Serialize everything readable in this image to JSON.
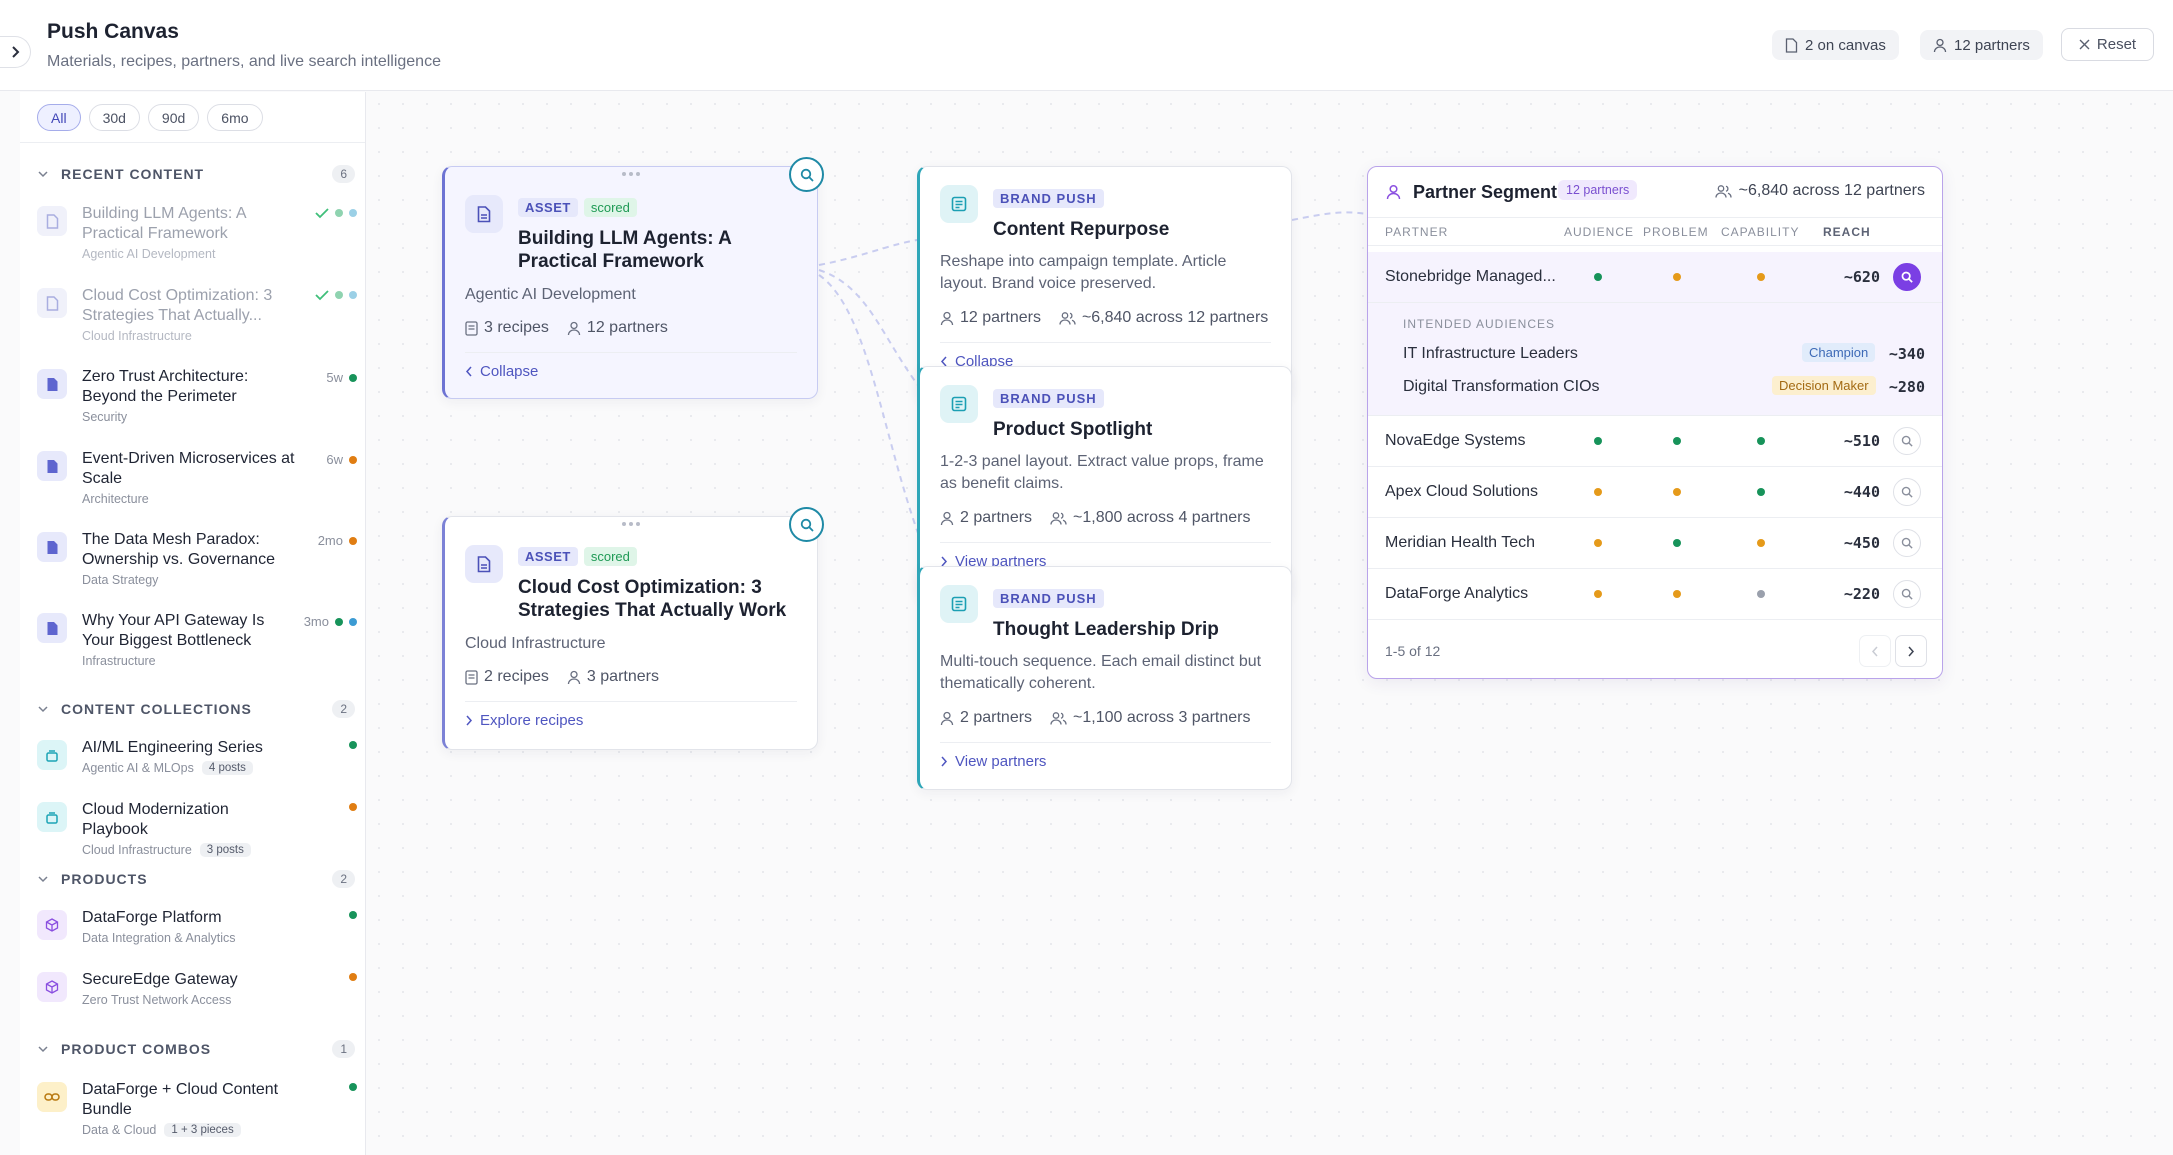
{
  "header": {
    "title": "Push Canvas",
    "subtitle": "Materials, recipes, partners, and live search intelligence",
    "on_canvas": "2 on canvas",
    "partners": "12 partners",
    "reset_label": "Reset"
  },
  "filters": [
    "All",
    "30d",
    "90d",
    "6mo"
  ],
  "sidebar": {
    "recent": {
      "label": "RECENT CONTENT",
      "count": "6",
      "items": [
        {
          "name": "Building LLM Agents: A Practical Framework",
          "category": "Agentic AI Development",
          "age": ""
        },
        {
          "name": "Cloud Cost Optimization: 3 Strategies That Actually...",
          "category": "Cloud Infrastructure",
          "age": ""
        },
        {
          "name": "Zero Trust Architecture: Beyond the Perimeter",
          "category": "Security",
          "age": "5w"
        },
        {
          "name": "Event-Driven Microservices at Scale",
          "category": "Architecture",
          "age": "6w"
        },
        {
          "name": "The Data Mesh Paradox: Ownership vs. Governance",
          "category": "Data Strategy",
          "age": "2mo"
        },
        {
          "name": "Why Your API Gateway Is Your Biggest Bottleneck",
          "category": "Infrastructure",
          "age": "3mo"
        }
      ]
    },
    "collections": {
      "label": "CONTENT COLLECTIONS",
      "count": "2",
      "items": [
        {
          "name": "AI/ML Engineering Series",
          "category": "Agentic AI & MLOps",
          "pill": "4 posts"
        },
        {
          "name": "Cloud Modernization Playbook",
          "category": "Cloud Infrastructure",
          "pill": "3 posts"
        }
      ]
    },
    "products": {
      "label": "PRODUCTS",
      "count": "2",
      "items": [
        {
          "name": "DataForge Platform",
          "category": "Data Integration & Analytics"
        },
        {
          "name": "SecureEdge Gateway",
          "category": "Zero Trust Network Access"
        }
      ]
    },
    "combos": {
      "label": "PRODUCT COMBOS",
      "count": "1",
      "items": [
        {
          "name": "DataForge + Cloud Content Bundle",
          "category": "Data & Cloud",
          "pill": "1 + 3 pieces"
        }
      ]
    }
  },
  "assets": [
    {
      "tag": "ASSET",
      "status": "scored",
      "title": "Building LLM Agents: A Practical Framework",
      "category": "Agentic AI Development",
      "recipes": "3 recipes",
      "partners": "12 partners",
      "link": "Collapse"
    },
    {
      "tag": "ASSET",
      "status": "scored",
      "title": "Cloud Cost Optimization: 3 Strategies That Actually Work",
      "category": "Cloud Infrastructure",
      "recipes": "2 recipes",
      "partners": "3 partners",
      "link": "Explore recipes"
    }
  ],
  "pushes": [
    {
      "tag": "BRAND PUSH",
      "title": "Content Repurpose",
      "desc": "Reshape into campaign template. Article layout. Brand voice preserved.",
      "partners": "12 partners",
      "reach": "~6,840 across 12 partners",
      "link": "Collapse"
    },
    {
      "tag": "BRAND PUSH",
      "title": "Product Spotlight",
      "desc": "1-2-3 panel layout. Extract value props, frame as benefit claims.",
      "partners": "2 partners",
      "reach": "~1,800 across 4 partners",
      "link": "View partners"
    },
    {
      "tag": "BRAND PUSH",
      "title": "Thought Leadership Drip",
      "desc": "Multi-touch sequence. Each email distinct but thematically coherent.",
      "partners": "2 partners",
      "reach": "~1,100 across 3 partners",
      "link": "View partners"
    }
  ],
  "segment": {
    "title": "Partner Segment",
    "badge": "12 partners",
    "reach": "~6,840 across 12 partners",
    "columns": [
      "PARTNER",
      "AUDIENCE",
      "PROBLEM",
      "CAPABILITY",
      "REACH"
    ],
    "rows": [
      {
        "name": "Stonebridge Managed...",
        "reach": "~620",
        "dots": [
          "green",
          "amber",
          "amber"
        ]
      },
      {
        "name": "NovaEdge Systems",
        "reach": "~510",
        "dots": [
          "green",
          "green",
          "green"
        ]
      },
      {
        "name": "Apex Cloud Solutions",
        "reach": "~440",
        "dots": [
          "amber",
          "amber",
          "green"
        ]
      },
      {
        "name": "Meridian Health Tech",
        "reach": "~450",
        "dots": [
          "amber",
          "green",
          "amber"
        ]
      },
      {
        "name": "DataForge Analytics",
        "reach": "~220",
        "dots": [
          "amber",
          "amber",
          "gray"
        ]
      }
    ],
    "expanded_label": "INTENDED AUDIENCES",
    "audiences": [
      {
        "name": "IT Infrastructure Leaders",
        "role": "Champion",
        "reach": "~340"
      },
      {
        "name": "Digital Transformation CIOs",
        "role": "Decision Maker",
        "reach": "~280"
      }
    ],
    "pagination": "1-5 of 12"
  },
  "colors": {
    "green": "#17935a",
    "amber": "#e59a1a",
    "gray": "#9aa0ac",
    "blue": "#3c9bd3",
    "accent": "#7b3fe4"
  }
}
